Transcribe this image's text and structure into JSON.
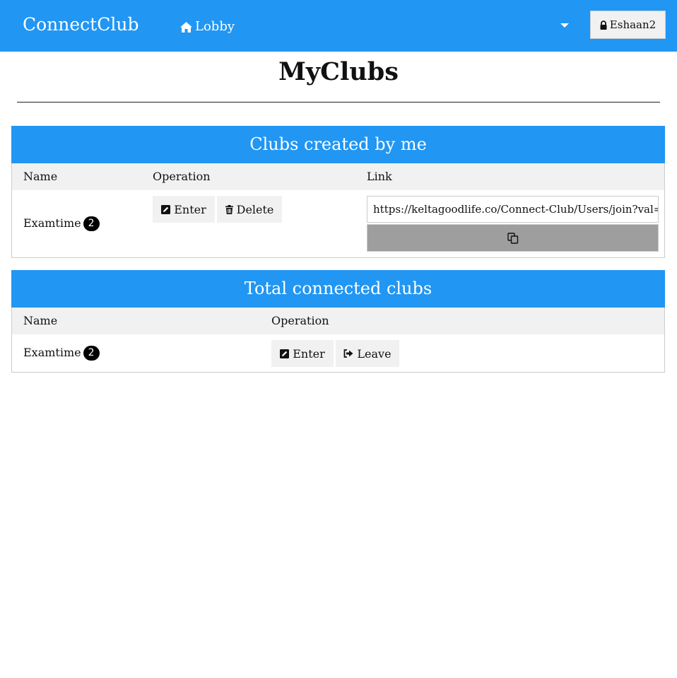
{
  "nav": {
    "brand": "ConnectClub",
    "lobby_label": "Lobby",
    "user_label": "Eshaan2"
  },
  "page": {
    "title": "MyClubs"
  },
  "created_clubs": {
    "header": "Clubs created by me",
    "columns": [
      "Name",
      "Operation",
      "Link"
    ],
    "rows": [
      {
        "name": "Examtime",
        "count": "2",
        "enter_label": "Enter",
        "delete_label": "Delete",
        "link": "https://keltagoodlife.co/Connect-Club/Users/join?val=e"
      }
    ]
  },
  "connected_clubs": {
    "header": "Total connected clubs",
    "columns": [
      "Name",
      "Operation"
    ],
    "rows": [
      {
        "name": "Examtime",
        "count": "2",
        "enter_label": "Enter",
        "leave_label": "Leave"
      }
    ]
  },
  "colors": {
    "primary": "#2196f3",
    "button_bg": "#f1f1f1",
    "copy_button": "#9e9e9e",
    "badge": "#000000"
  },
  "icons": [
    "home-icon",
    "caret-down-icon",
    "lock-icon",
    "edit-icon",
    "trash-icon",
    "copy-icon",
    "sign-out-icon"
  ]
}
